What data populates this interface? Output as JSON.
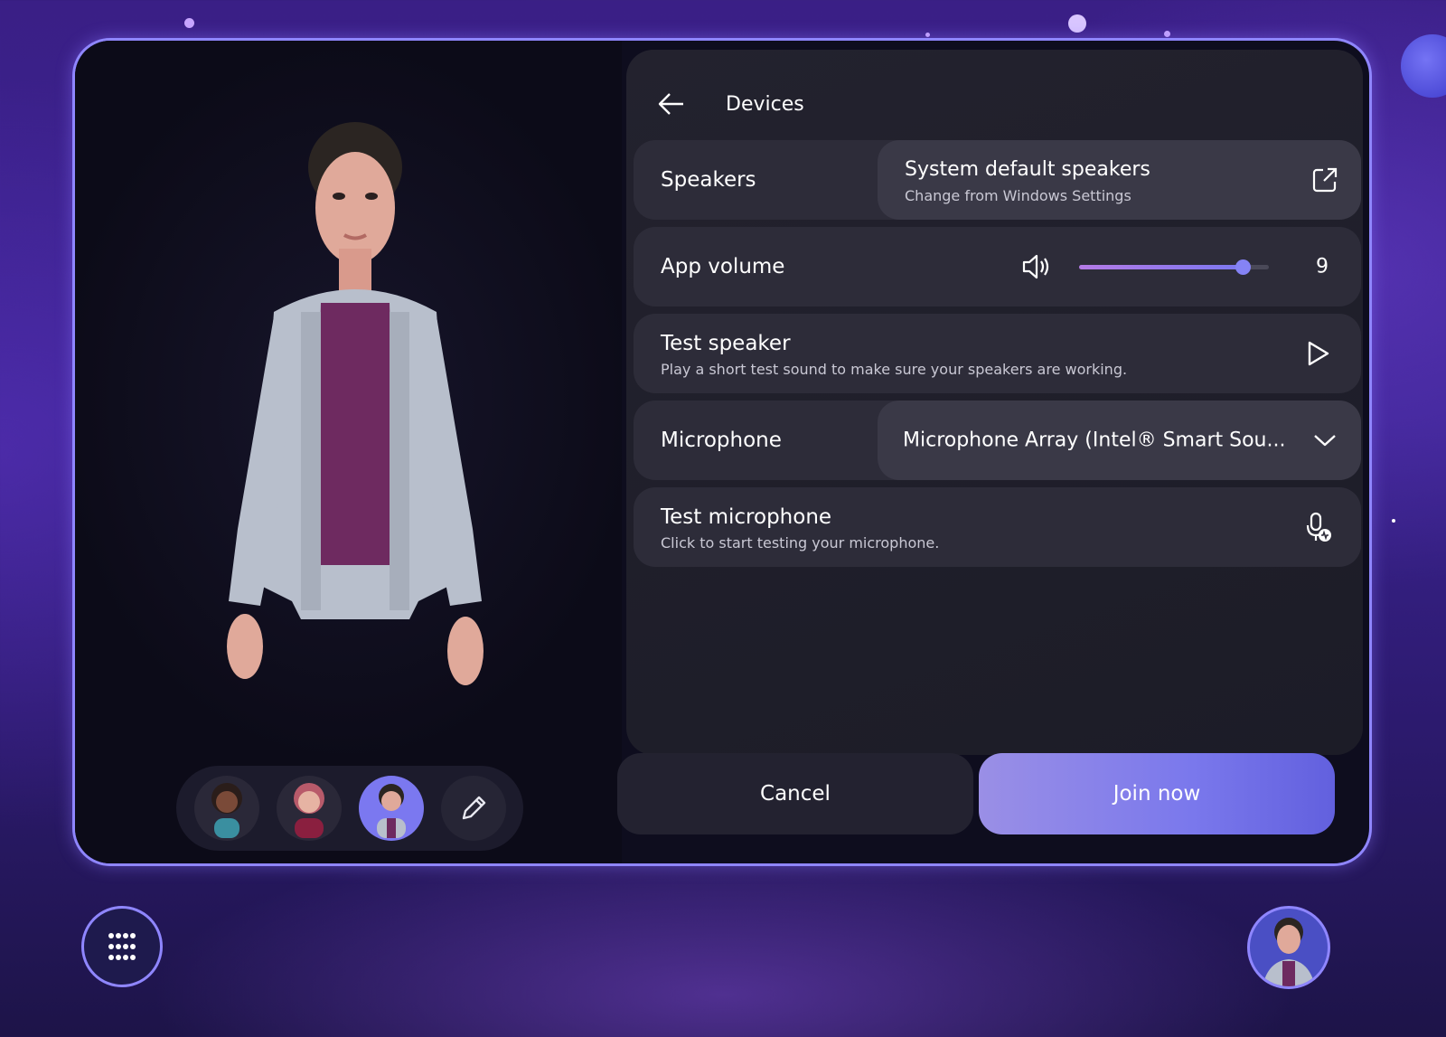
{
  "header": {
    "title": "Devices",
    "back_icon": "arrow-left-icon"
  },
  "speakers": {
    "label": "Speakers",
    "device": "System default speakers",
    "hint": "Change from Windows Settings",
    "icon": "open-external-icon"
  },
  "app_volume": {
    "label": "App volume",
    "value": "9",
    "level_fraction": 0.86,
    "icon": "speaker-volume-icon"
  },
  "test_speaker": {
    "title": "Test speaker",
    "description": "Play a short test sound to make sure your speakers are working.",
    "icon": "play-icon"
  },
  "microphone": {
    "label": "Microphone",
    "device": "Microphone Array (Intel® Smart Sou...",
    "icon": "chevron-down-icon"
  },
  "test_microphone": {
    "title": "Test microphone",
    "description": "Click to start testing your microphone.",
    "icon": "microphone-test-icon"
  },
  "actions": {
    "cancel_label": "Cancel",
    "join_label": "Join now"
  },
  "avatar_strip": {
    "avatars": [
      "avatar-1",
      "avatar-2",
      "avatar-3"
    ],
    "selected_index": 2,
    "edit_icon": "pencil-icon"
  },
  "colors": {
    "accent": "#7b78f0",
    "frame": "#8f86ff",
    "background": "#3a1f86"
  }
}
